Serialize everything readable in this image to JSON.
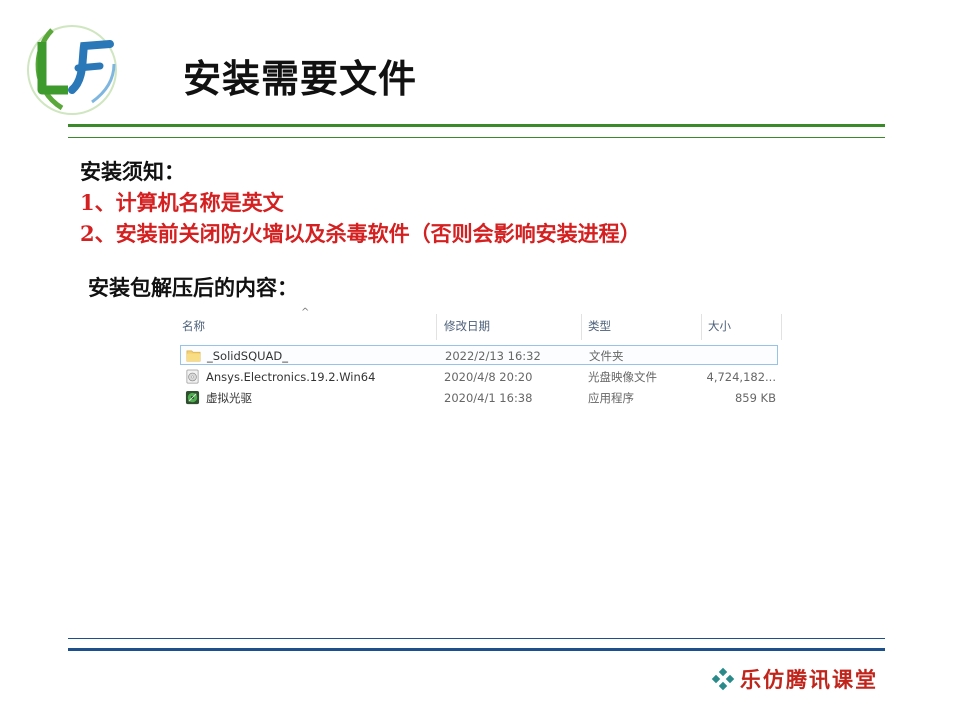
{
  "slide": {
    "title": "安装需要文件",
    "notes_heading": "安装须知：",
    "notes": [
      "1、计算机名称是英文",
      "2、安装前关闭防火墙以及杀毒软件（否则会影响安装进程）"
    ],
    "package_heading": "安装包解压后的内容：",
    "footer": "乐仿腾讯课堂"
  },
  "explorer": {
    "columns": {
      "name": "名称",
      "date": "修改日期",
      "type": "类型",
      "size": "大小"
    },
    "rows": [
      {
        "name": "_SolidSQUAD_",
        "date": "2022/2/13 16:32",
        "type": "文件夹",
        "size": "",
        "icon": "folder-icon"
      },
      {
        "name": "Ansys.Electronics.19.2.Win64",
        "date": "2020/4/8 20:20",
        "type": "光盘映像文件",
        "size": "4,724,182...",
        "icon": "disc-image-icon"
      },
      {
        "name": "虚拟光驱",
        "date": "2020/4/1 16:38",
        "type": "应用程序",
        "size": "859 KB",
        "icon": "application-icon"
      }
    ]
  },
  "colors": {
    "green_rule": "#3a8a2a",
    "blue_rule": "#1d4f8c",
    "red_text": "#d42020",
    "footer_red": "#c0251c"
  }
}
